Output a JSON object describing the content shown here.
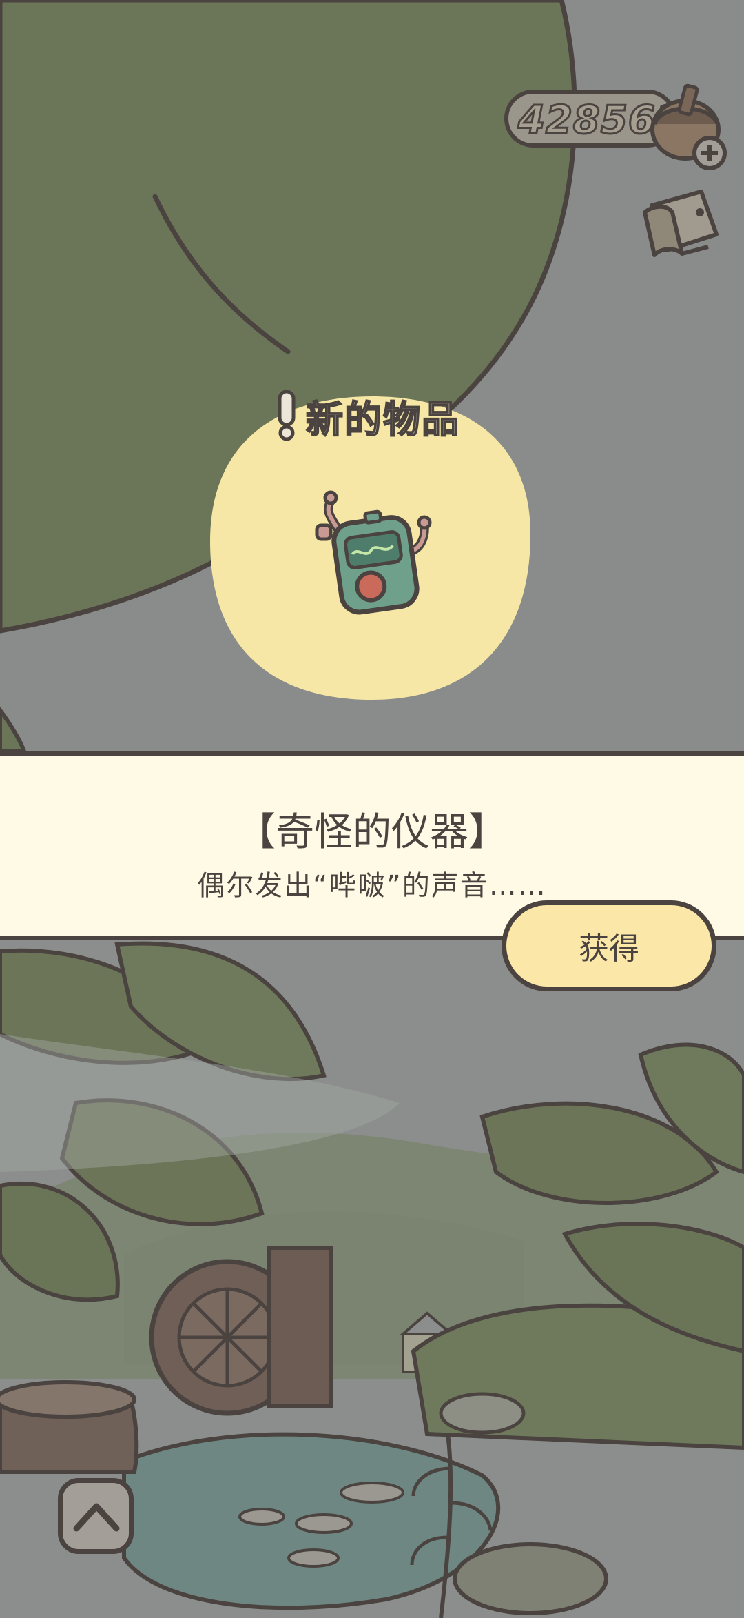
{
  "hud": {
    "currency_value": "428562",
    "currency_icon": "acorn-clover-icon",
    "add_icon": "plus-icon",
    "album_icon": "photo-album-icon"
  },
  "popup": {
    "header": "新的物品",
    "header_icon": "exclamation-icon",
    "item_icon": "strange-device-icon",
    "item_name": "【奇怪的仪器】",
    "item_description": "偶尔发出“哔啵”的声音……",
    "obtain_label": "获得"
  },
  "bottom": {
    "expand_icon": "chevron-up-icon"
  },
  "colors": {
    "outline": "#4a4340",
    "panel_bg": "#fffae6",
    "glow": "#f6e7a6",
    "button_bg": "#fbe8a8",
    "dim_overlay": "#8a8d8c"
  }
}
